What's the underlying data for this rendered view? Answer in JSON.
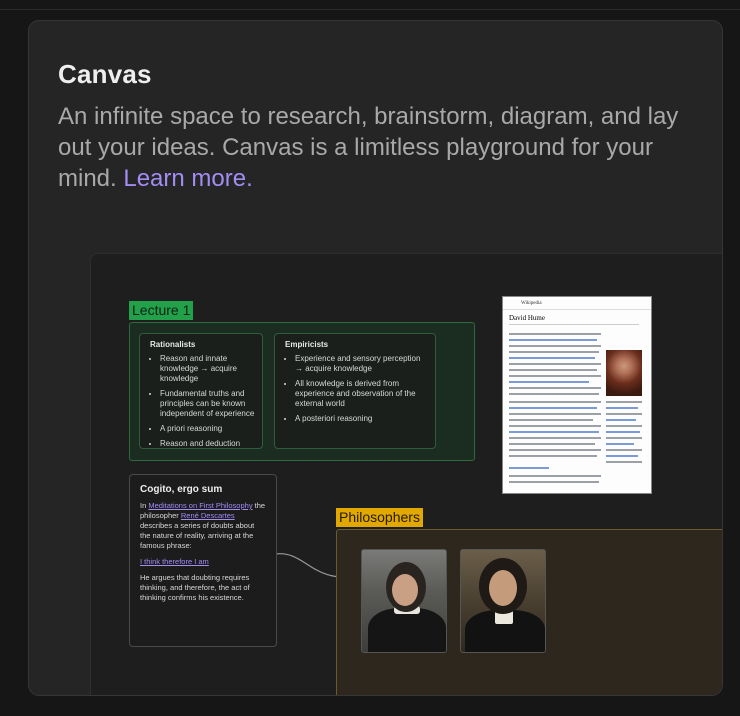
{
  "card": {
    "title": "Canvas",
    "description": "An infinite space to research, brainstorm, diagram, and lay out your ideas. Canvas is a limitless playground for your mind.",
    "learn_more": "Learn more."
  },
  "canvas_preview": {
    "lecture": {
      "label": "Lecture 1",
      "notes": [
        {
          "heading": "Rationalists",
          "bullets": [
            "Reason and innate knowledge → acquire knowledge",
            "Fundamental truths and principles can be known independent of experience",
            "A priori reasoning",
            "Reason and deduction"
          ]
        },
        {
          "heading": "Empiricists",
          "bullets": [
            "Experience and sensory perception → acquire knowledge",
            "All knowledge is derived from experience and observation of the external world",
            "A posteriori reasoning"
          ]
        }
      ]
    },
    "wiki_page": {
      "site": "Wikipedia",
      "title": "David Hume"
    },
    "cogito": {
      "title": "Cogito, ergo sum",
      "p1_prefix": "In",
      "p1_link1": "Meditations on First Philosophy",
      "p1_mid": "the philosopher",
      "p1_link2": "René Descartes",
      "p1_suffix": "describes a series of doubts about the nature of reality, arriving at the famous phrase:",
      "quote_link": "I think therefore I am",
      "p2": "He argues that doubting requires thinking, and therefore, the act of thinking confirms his existence."
    },
    "philosophers": {
      "label": "Philosophers"
    }
  }
}
